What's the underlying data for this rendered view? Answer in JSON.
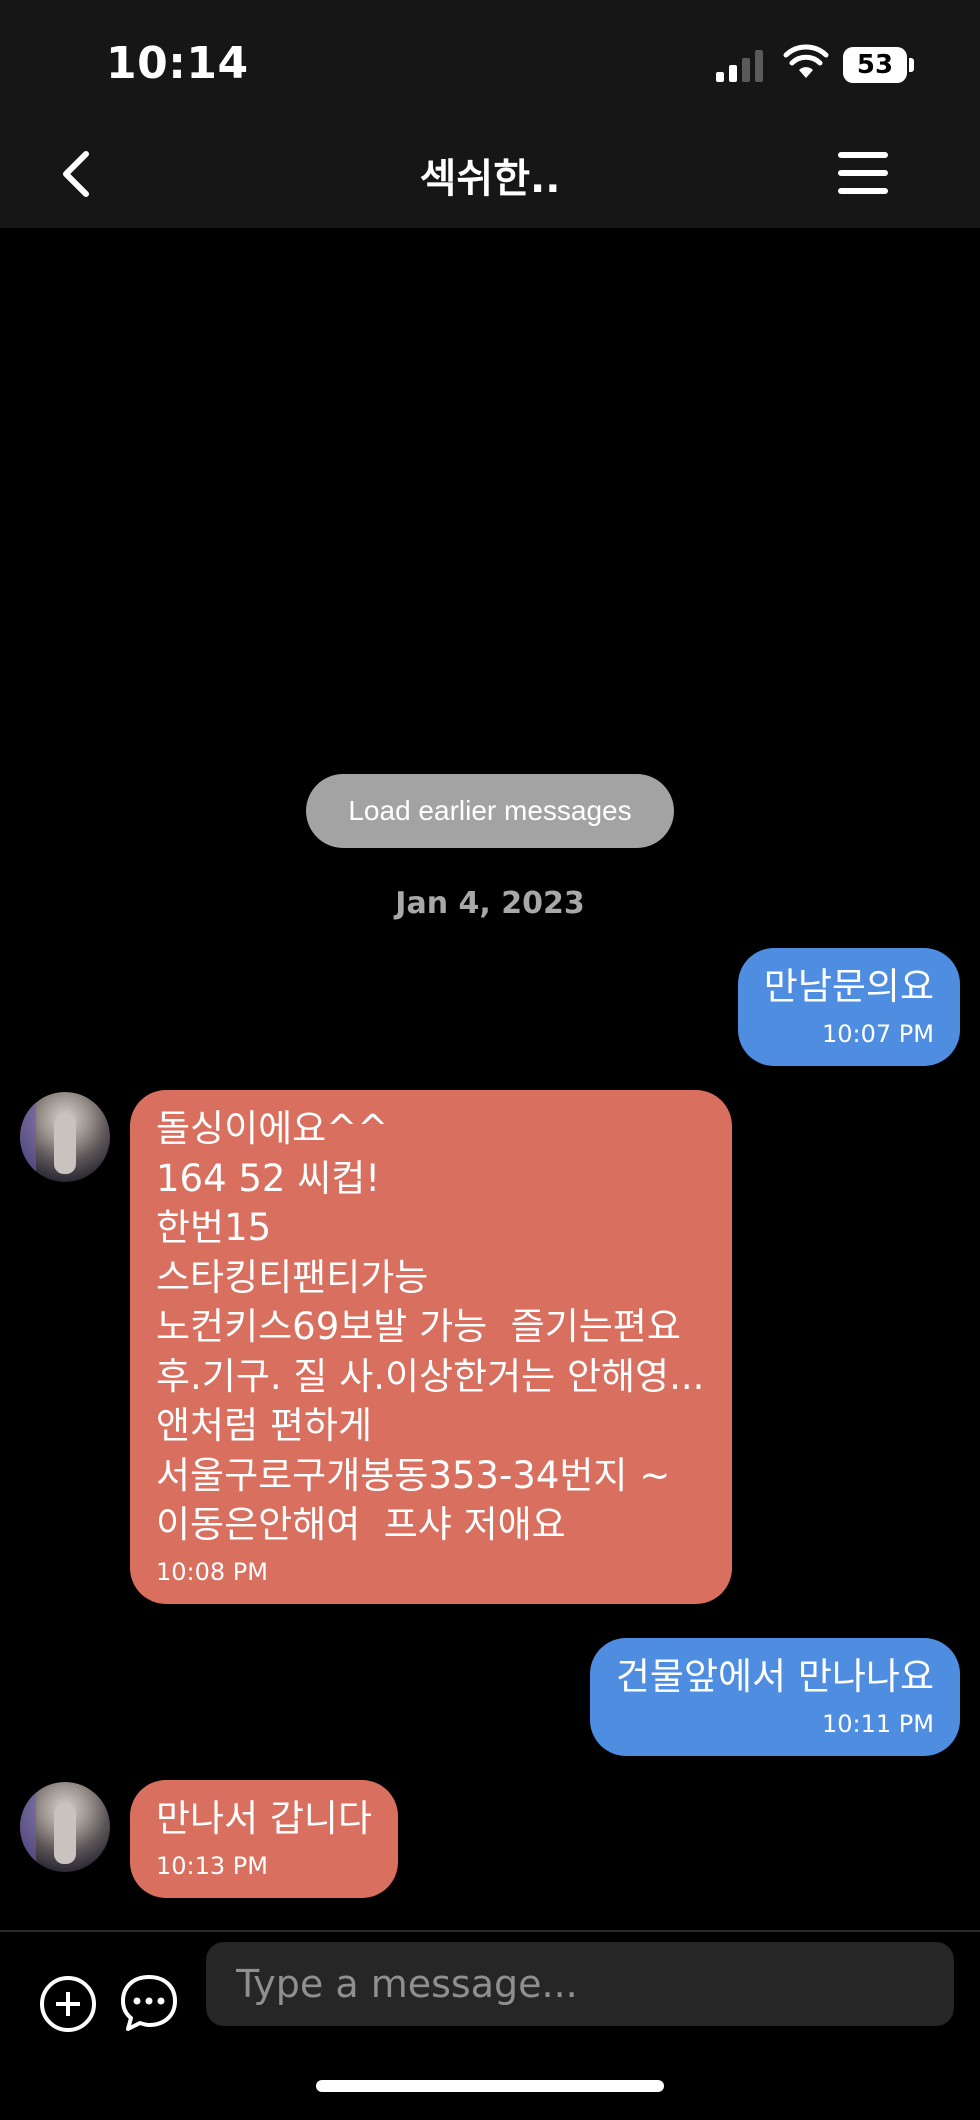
{
  "status_bar": {
    "time": "10:14",
    "battery": "53"
  },
  "header": {
    "title": "섹쉬한..",
    "icons": {
      "back": "chevron-left-icon",
      "menu": "hamburger-menu-icon"
    }
  },
  "chat": {
    "load_earlier_label": "Load earlier messages",
    "date": "Jan 4, 2023",
    "messages": [
      {
        "direction": "outgoing",
        "text": "만남문의요",
        "time": "10:07 PM"
      },
      {
        "direction": "incoming",
        "text": "돌싱이에요^^\n164 52 씨컵!\n한번15\n스타킹티팬티가능\n노컨키스69보발 가능  즐기는편요\n후.기구. 질 사.이상한거는 안해영...\n앤처럼 편하게\n서울구로구개봉동353-34번지 ~\n이동은안해여  프샤 저애요",
        "time": "10:08 PM"
      },
      {
        "direction": "outgoing",
        "text": "건물앞에서 만나나요",
        "time": "10:11 PM"
      },
      {
        "direction": "incoming",
        "text": "만나서 갑니다",
        "time": "10:13 PM"
      }
    ]
  },
  "composer": {
    "placeholder": "Type a message...",
    "icons": {
      "add": "plus-circle-icon",
      "chat": "chat-bubble-icon"
    }
  },
  "colors": {
    "outgoing_bubble": "#4f8de1",
    "incoming_bubble": "#d86f5f",
    "background": "#000000",
    "bar": "#161616"
  }
}
